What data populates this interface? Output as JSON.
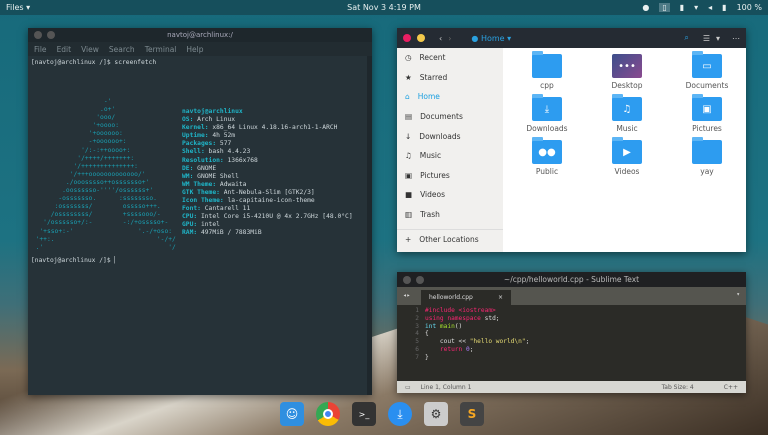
{
  "topbar": {
    "app_menu": "Files ▾",
    "clock": "Sat Nov 3  4:19 PM",
    "battery": "100 %"
  },
  "terminal": {
    "title": "navtoj@archlinux:/",
    "menu": [
      "File",
      "Edit",
      "View",
      "Search",
      "Terminal",
      "Help"
    ],
    "prompt1": "[navtoj@archlinux /]$ screenfetch",
    "prompt2": "[navtoj@archlinux /]$ ",
    "userhost": "navtoj@archlinux",
    "info": [
      [
        "OS:",
        "Arch Linux"
      ],
      [
        "Kernel:",
        "x86_64 Linux 4.18.16-arch1-1-ARCH"
      ],
      [
        "Uptime:",
        "4h 52m"
      ],
      [
        "Packages:",
        "577"
      ],
      [
        "Shell:",
        "bash 4.4.23"
      ],
      [
        "Resolution:",
        "1366x768"
      ],
      [
        "DE:",
        "GNOME"
      ],
      [
        "WM:",
        "GNOME Shell"
      ],
      [
        "WM Theme:",
        "Adwaita"
      ],
      [
        "GTK Theme:",
        "Ant-Nebula-Slim [GTK2/3]"
      ],
      [
        "Icon Theme:",
        "la-capitaine-icon-theme"
      ],
      [
        "Font:",
        "Cantarell 11"
      ],
      [
        "CPU:",
        "Intel Core i5-4210U @ 4x 2.7GHz [48.0°C]"
      ],
      [
        "GPU:",
        "intel"
      ],
      [
        "RAM:",
        "497MiB / 7883MiB"
      ]
    ],
    "ascii": "                    -'\n                   .o+'\n                  'ooo/\n                 '+oooo:\n                '+oooooo:\n                -+oooooo+:\n              '/:-:++oooo+:\n             '/++++/+++++++:\n            '/++++++++++++++:\n           '/+++ooooooooooooo/'\n          ./ooosssso++osssssso+'\n         .oossssso-''''/ossssss+'\n        -osssssso.      :ssssssso.\n       :osssssss/        osssso+++.\n      /ossssssss/        +ssssooo/-\n    '/ossssso+/:-        -:/+osssso+-\n   '+sso+:-'                 '.-/+oso:\n  '++:.                           '-/+/\n  .'                                 '/"
  },
  "files": {
    "location": "Home",
    "sidebar": [
      "Recent",
      "Starred",
      "Home",
      "Documents",
      "Downloads",
      "Music",
      "Pictures",
      "Videos",
      "Trash",
      "Other Locations"
    ],
    "sidebar_icons": [
      "◷",
      "★",
      "⌂",
      "▤",
      "↓",
      "♫",
      "▣",
      "■",
      "▥",
      "+"
    ],
    "items": [
      {
        "name": "cpp",
        "icon": ""
      },
      {
        "name": "Desktop",
        "icon": "•••"
      },
      {
        "name": "Documents",
        "icon": "▭"
      },
      {
        "name": "Downloads",
        "icon": "⤓"
      },
      {
        "name": "Music",
        "icon": "♫"
      },
      {
        "name": "Pictures",
        "icon": "▣"
      },
      {
        "name": "Public",
        "icon": "●●"
      },
      {
        "name": "Videos",
        "icon": "▶"
      },
      {
        "name": "yay",
        "icon": ""
      }
    ]
  },
  "sublime": {
    "title": "~/cpp/helloworld.cpp - Sublime Text",
    "tab": "helloworld.cpp",
    "tab_close": "×",
    "code": [
      [
        [
          "kw",
          "#include <iostream>"
        ]
      ],
      [
        [
          "kw",
          "using namespace"
        ],
        [
          "pl",
          " std;"
        ]
      ],
      [
        [
          "ty",
          "int"
        ],
        [
          "pl",
          " "
        ],
        [
          "fn",
          "main"
        ],
        [
          "pl",
          "()"
        ]
      ],
      [
        [
          "pl",
          "{"
        ]
      ],
      [
        [
          "pl",
          "    cout << "
        ],
        [
          "st",
          "\"hello world\\n\""
        ],
        [
          "pl",
          ";"
        ]
      ],
      [
        [
          "pl",
          "    "
        ],
        [
          "kw",
          "return"
        ],
        [
          "pl",
          " "
        ],
        [
          "nm",
          "0"
        ],
        [
          "pl",
          ";"
        ]
      ],
      [
        [
          "pl",
          "}"
        ]
      ]
    ],
    "status_left": "Line 1, Column 1",
    "tab_size": "Tab Size: 4",
    "syntax": "C++"
  }
}
